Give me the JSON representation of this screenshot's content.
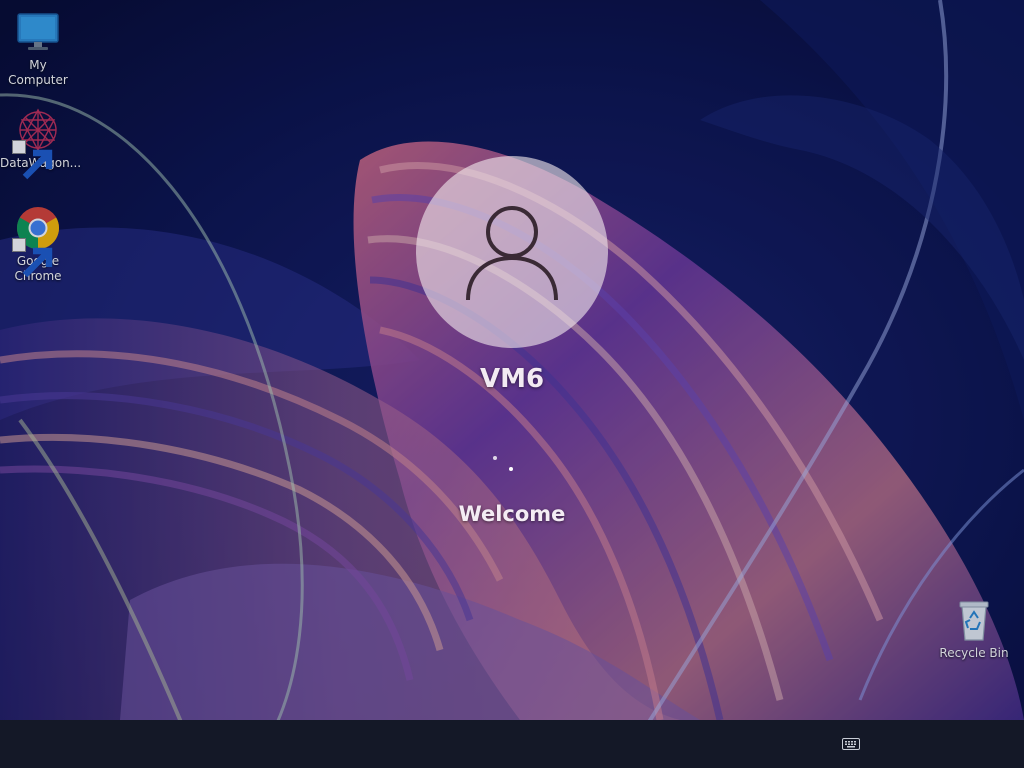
{
  "colors": {
    "background": "#0b1240",
    "taskbar": "#141827",
    "text": "#ffffff"
  },
  "desktop": {
    "icons": [
      {
        "label": "My Computer",
        "icon": "monitor-icon"
      },
      {
        "label": "DataWagon...",
        "icon": "datawagon-logo-icon",
        "shortcut": true
      },
      {
        "label": "Google Chrome",
        "icon": "chrome-icon",
        "shortcut": true
      },
      {
        "label": "Recycle Bin",
        "icon": "recycle-bin-icon"
      }
    ]
  },
  "login": {
    "username": "VM6",
    "status": "Welcome",
    "avatar_icon": "user-icon"
  },
  "taskbar": {
    "keyboard_icon": "keyboard-icon"
  }
}
